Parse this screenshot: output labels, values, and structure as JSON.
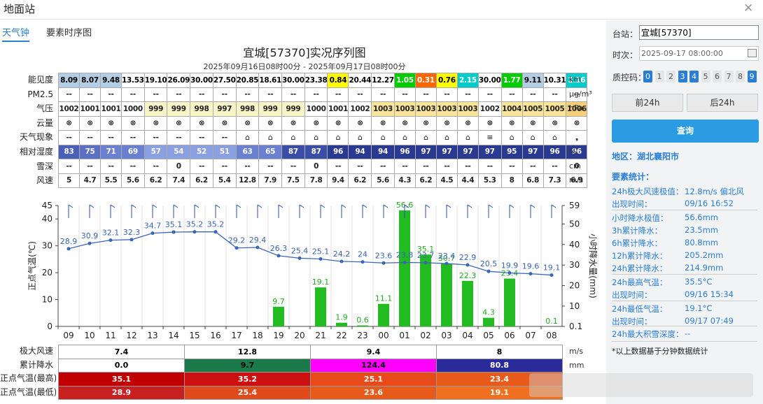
{
  "window": {
    "title": "地面站"
  },
  "tabs": [
    "天气钟",
    "要素时序图"
  ],
  "chart_title": "宜城[57370]实况序列图",
  "chart_subtitle": "2025年09月16日08时00分 - 2025年09月17日08时00分",
  "hours": [
    "09",
    "10",
    "11",
    "12",
    "13",
    "14",
    "15",
    "16",
    "17",
    "18",
    "19",
    "20",
    "21",
    "22",
    "23",
    "00",
    "01",
    "02",
    "03",
    "04",
    "05",
    "06",
    "07",
    "08"
  ],
  "rows": [
    {
      "label": "能见度",
      "unit": "km",
      "values": [
        "8.09",
        "8.07",
        "9.48",
        "13.53",
        "19.10",
        "26.09",
        "30.00",
        "27.50",
        "20.85",
        "18.61",
        "30.00",
        "23.38",
        "0.84",
        "20.44",
        "12.27",
        "1.05",
        "0.31",
        "0.76",
        "2.15",
        "30.00",
        "1.77",
        "9.11",
        "10.31",
        "2.16"
      ],
      "colors": [
        "#b3cde3",
        "#b3cde3",
        "#b3cde3",
        "#ffffff",
        "#ffffff",
        "#ffffff",
        "#ffffff",
        "#ffffff",
        "#ffffff",
        "#ffffff",
        "#ffffff",
        "#ffffff",
        "#ffff00",
        "#ffffff",
        "#ffffff",
        "#00cc00",
        "#ff6600",
        "#ffff00",
        "#00cccc",
        "#ffffff",
        "#00cc00",
        "#b3cde3",
        "#ffffff",
        "#00cccc"
      ],
      "text_colors": [
        "#000",
        "#000",
        "#000",
        "#000",
        "#000",
        "#000",
        "#000",
        "#000",
        "#000",
        "#000",
        "#000",
        "#000",
        "#000",
        "#000",
        "#000",
        "#fff",
        "#fff",
        "#000",
        "#fff",
        "#000",
        "#fff",
        "#000",
        "#000",
        "#fff"
      ]
    },
    {
      "label": "PM2.5",
      "unit": "μg/m³",
      "values": [
        "--",
        "--",
        "--",
        "--",
        "--",
        "--",
        "--",
        "--",
        "--",
        "--",
        "--",
        "--",
        "--",
        "--",
        "--",
        "--",
        "--",
        "--",
        "--",
        "--",
        "--",
        "--",
        "--",
        "--"
      ]
    },
    {
      "label": "气压",
      "unit": "hPa",
      "values": [
        "1002",
        "1001",
        "1001",
        "1000",
        "999",
        "999",
        "998",
        "997",
        "998",
        "999",
        "999",
        "1000",
        "1001",
        "1002",
        "1003",
        "1003",
        "1003",
        "1003",
        "1003",
        "1002",
        "1004",
        "1005",
        "1005",
        "1006"
      ],
      "colors": [
        "#ffffff",
        "#ffffff",
        "#ffffff",
        "#ffffff",
        "#f5f5c8",
        "#f5f5c8",
        "#f5f5c8",
        "#f5f5c8",
        "#f5f5c8",
        "#f5f5c8",
        "#f5f5c8",
        "#ffffff",
        "#ffffff",
        "#ffffff",
        "#f9e49a",
        "#f9e49a",
        "#f9e49a",
        "#f9e49a",
        "#f9e49a",
        "#ffffff",
        "#f9e49a",
        "#f9e49a",
        "#f9e49a",
        "#f9d07a"
      ]
    },
    {
      "label": "云量",
      "unit": "",
      "values": [
        "⊗",
        "⊗",
        "⊗",
        "⊗",
        "⊗",
        "⊗",
        "⊗",
        "⊗",
        "⊗",
        "⊗",
        "⊗",
        "⊗",
        "⊗",
        "⊗",
        "⊗",
        "⊗",
        "⊗",
        "⊗",
        "⊗",
        "⊗",
        "⊗",
        "⊗",
        "⊗",
        "⊗"
      ]
    },
    {
      "label": "天气现象",
      "unit": "",
      "values": [
        "--",
        "--",
        "--",
        "--",
        "--",
        "--",
        "--",
        "--",
        "⌂",
        "⌂",
        "⌂",
        "⌂",
        "⌂",
        "⌂",
        "⌂",
        "⌂",
        "⌂",
        "⌂",
        "⌂",
        "≡",
        "⌂",
        "⌂",
        "⌂",
        "❟"
      ]
    },
    {
      "label": "相对湿度",
      "unit": "%",
      "values": [
        "83",
        "75",
        "71",
        "69",
        "57",
        "54",
        "52",
        "51",
        "63",
        "65",
        "87",
        "87",
        "96",
        "94",
        "94",
        "96",
        "97",
        "97",
        "97",
        "97",
        "95",
        "97",
        "96",
        "96"
      ],
      "colors": [
        "#4a5fb8",
        "#5b70c4",
        "#6a80d0",
        "#6a80d0",
        "#8aa0e0",
        "#8aa0e0",
        "#8aa0e0",
        "#8aa0e0",
        "#6a80d0",
        "#6a80d0",
        "#3a4ea8",
        "#3a4ea8",
        "#2a3a90",
        "#2a3a90",
        "#2a3a90",
        "#2a3a90",
        "#2a3a90",
        "#2a3a90",
        "#2a3a90",
        "#2a3a90",
        "#2a3a90",
        "#2a3a90",
        "#2a3a90",
        "#2a3a90"
      ],
      "text_colors": [
        "#fff",
        "#fff",
        "#fff",
        "#fff",
        "#fff",
        "#fff",
        "#fff",
        "#fff",
        "#fff",
        "#fff",
        "#fff",
        "#fff",
        "#fff",
        "#fff",
        "#fff",
        "#fff",
        "#fff",
        "#fff",
        "#fff",
        "#fff",
        "#fff",
        "#fff",
        "#fff",
        "#fff"
      ]
    },
    {
      "label": "雪深",
      "unit": "cm",
      "values": [
        "--",
        "--",
        "--",
        "--",
        "--",
        "0",
        "--",
        "--",
        "--",
        "--",
        "--",
        "0",
        "--",
        "--",
        "--",
        "--",
        "--",
        "--",
        "--",
        "--",
        "--",
        "--",
        "--",
        "0"
      ]
    },
    {
      "label": "风速",
      "unit": "m/s",
      "values": [
        "5",
        "4.7",
        "5.5",
        "5.6",
        "6.2",
        "7.4",
        "6.2",
        "5.4",
        "12.8",
        "7.9",
        "7.5",
        "7.8",
        "9.4",
        "6.2",
        "5.6",
        "4.3",
        "6.2",
        "4.5",
        "4.4",
        "5.3",
        "8",
        "6.8",
        "7.3",
        "6.9"
      ]
    }
  ],
  "chart_data": {
    "type": "bar+line",
    "x": [
      "09",
      "10",
      "11",
      "12",
      "13",
      "14",
      "15",
      "16",
      "17",
      "18",
      "19",
      "20",
      "21",
      "22",
      "23",
      "00",
      "01",
      "02",
      "03",
      "04",
      "05",
      "06",
      "07",
      "08"
    ],
    "series": [
      {
        "name": "正点气温(℃)",
        "type": "line",
        "values": [
          28.9,
          30.9,
          32.1,
          32.3,
          34.7,
          35.1,
          35.2,
          35.2,
          29.2,
          29.4,
          26.3,
          25.4,
          25.1,
          24.2,
          24,
          23.6,
          23.8,
          23.7,
          23.4,
          22.9,
          20.5,
          19.9,
          19.6,
          19.1
        ],
        "labels": [
          "28.9",
          "30.9",
          "32.1",
          "32.3",
          "34.7",
          "35.1",
          "35.2",
          "35.2",
          "29.2",
          "29.4",
          "26.3",
          "25.4",
          "25.1",
          "24.2",
          "24",
          "23.6",
          "23.8",
          "23.7",
          "23.4",
          "22.9",
          "20.5",
          "19.9",
          "19.6",
          "19.1"
        ],
        "color": "#3a66b8"
      },
      {
        "name": "小时降水量(mm)",
        "type": "bar",
        "values": [
          0,
          0,
          0,
          0,
          0,
          0,
          0,
          0,
          0,
          0,
          9.7,
          0,
          19.1,
          1.9,
          0.6,
          11.1,
          56.6,
          35.1,
          30.7,
          22.3,
          4.3,
          23.4,
          0,
          0.1
        ],
        "labels": [
          "",
          "",
          "",
          "",
          "",
          "",
          "",
          "",
          "",
          "",
          "9.7",
          "",
          "19.1",
          "1.9",
          "0.6",
          "11.1",
          "56.6",
          "35.1",
          "30.7",
          "22.3",
          "4.3",
          "23.4",
          "",
          "0.1"
        ],
        "color": "#22bb22"
      }
    ],
    "left_axis": {
      "label": "正点气温(℃)",
      "range": [
        0,
        45
      ],
      "ticks": [
        "0",
        "10",
        "20",
        "30",
        "40",
        "45"
      ]
    },
    "right_axis": {
      "label": "小时降水量(mm)",
      "range": [
        0.1,
        59
      ],
      "ticks": [
        "0.1",
        "10",
        "20",
        "30",
        "40",
        "50",
        "59"
      ]
    },
    "wind_barbs": true
  },
  "summary": {
    "rows": [
      {
        "label": "极大风速",
        "unit": "m/s",
        "cells": [
          "7.4",
          "12.8",
          "9.4",
          "8"
        ],
        "colors": [
          "#ffffff",
          "#ffffff",
          "#ffffff",
          "#ffffff"
        ],
        "text_colors": [
          "#000",
          "#000",
          "#000",
          "#000"
        ]
      },
      {
        "label": "累计降水",
        "unit": "mm",
        "cells": [
          "0.0",
          "9.7",
          "124.4",
          "80.8"
        ],
        "colors": [
          "#ffffff",
          "#1a7a4a",
          "#ff00ff",
          "#2a2a9a"
        ],
        "text_colors": [
          "#000",
          "#000",
          "#000",
          "#fff"
        ]
      },
      {
        "label": "正点气温(最高)",
        "unit": "",
        "cells": [
          "35.1",
          "35.2",
          "25.1",
          "23.4"
        ],
        "colors": [
          "#c00000",
          "#cc1010",
          "#e84a1a",
          "#e85a1a"
        ],
        "text_colors": [
          "#fff",
          "#fff",
          "#fff",
          "#fff"
        ]
      },
      {
        "label": "正点气温(最低)",
        "unit": "",
        "cells": [
          "28.9",
          "25.4",
          "23.6",
          "19.1"
        ],
        "colors": [
          "#c82020",
          "#e04a1a",
          "#e85a1a",
          "#f07020"
        ],
        "text_colors": [
          "#fff",
          "#fff",
          "#fff",
          "#fff"
        ]
      }
    ]
  },
  "right": {
    "station_label": "台站：",
    "station_value": "宜城[57370]",
    "time_label": "时次：",
    "time_value": "2025-09-17 08:00:00",
    "qc_label": "质控码：",
    "qc_codes": [
      "0",
      "1",
      "2",
      "3",
      "4",
      "5",
      "6",
      "7",
      "8",
      "9"
    ],
    "qc_active": [
      true,
      false,
      false,
      true,
      true,
      false,
      false,
      false,
      false,
      true
    ],
    "prev_label": "前24h",
    "next_label": "后24h",
    "query_label": "查询",
    "region": "地区：湖北襄阳市",
    "stats_title": "要素统计：",
    "stats": [
      {
        "k": "24h极大风速极值：",
        "v": "12.8m/s 偏北风"
      },
      {
        "k": "出现时间：",
        "v": "09/16 16:52"
      },
      {
        "k": "小时降水极值：",
        "v": "56.6mm"
      },
      {
        "k": "3h累计降水：",
        "v": "23.5mm"
      },
      {
        "k": "6h累计降水：",
        "v": "80.8mm"
      },
      {
        "k": "12h累计降水：",
        "v": "205.2mm"
      },
      {
        "k": "24h累计降水：",
        "v": "214.9mm"
      },
      {
        "k": "24h最高气温：",
        "v": "35.5°C"
      },
      {
        "k": "出现时间：",
        "v": "09/16 15:34"
      },
      {
        "k": "24h最低气温：",
        "v": "19.1°C"
      },
      {
        "k": "出现时间：",
        "v": "09/17 07:49"
      },
      {
        "k": "24h最大积雪深度：",
        "v": "--"
      }
    ],
    "note": "*以上数据基于分钟数据统计"
  }
}
